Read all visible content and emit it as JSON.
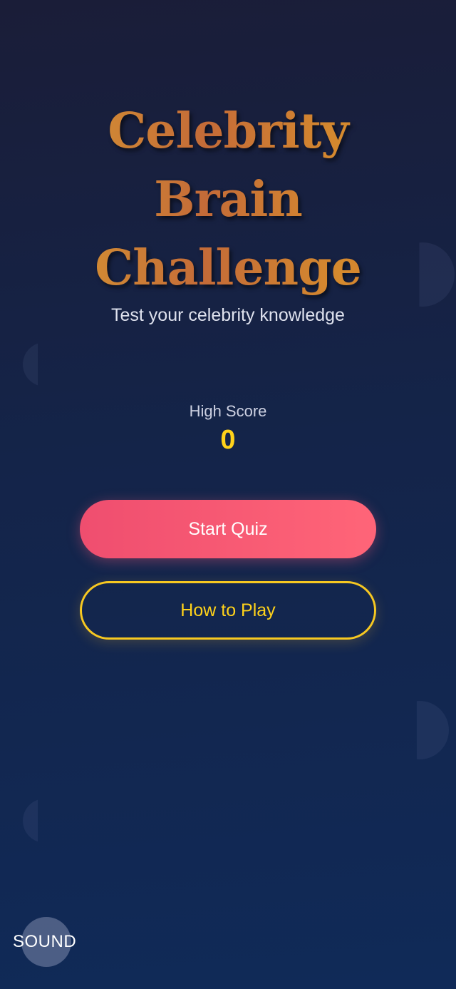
{
  "app": {
    "title_lines": [
      "Celebrity",
      "Brain",
      "Challenge"
    ],
    "subtitle": "Test your celebrity knowledge"
  },
  "high_score": {
    "label": "High Score",
    "value": "0"
  },
  "buttons": {
    "start": "Start Quiz",
    "how_to_play": "How to Play",
    "sound": "SOUND"
  },
  "colors": {
    "background_top": "#1a1d38",
    "background_bottom": "#102a58",
    "title_gold": "#d18a34",
    "title_orange": "#c46b38",
    "score_yellow": "#ffd21a",
    "start_button": "#f45a73",
    "howto_border": "#f7c821"
  }
}
